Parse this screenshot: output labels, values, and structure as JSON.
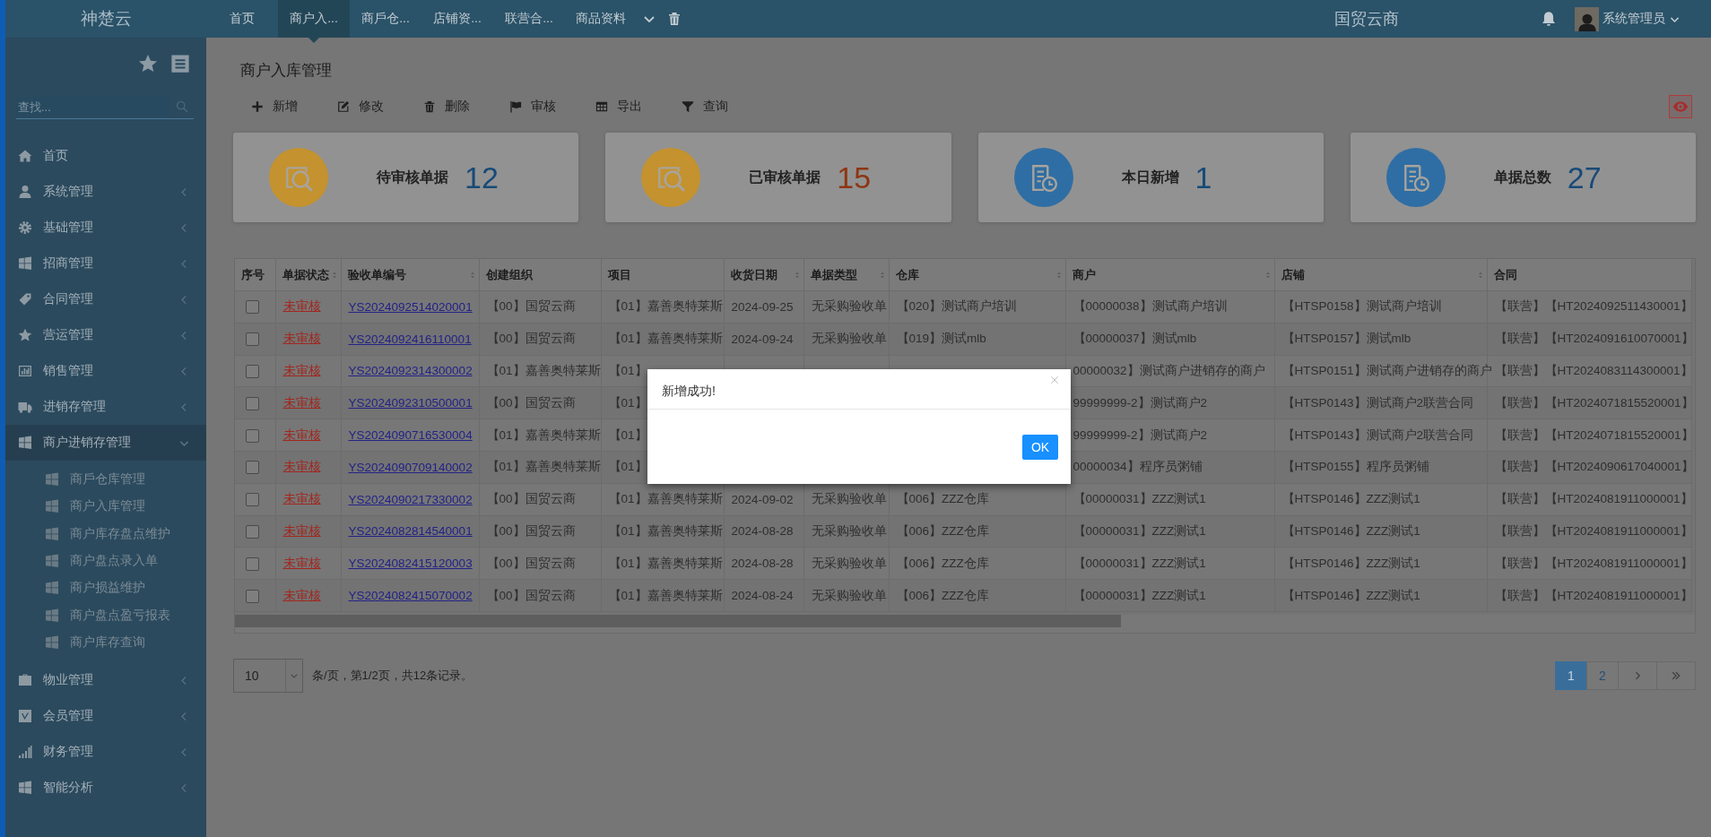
{
  "topbar": {
    "logo": "神楚云",
    "tabs": [
      {
        "label": "首页",
        "selected": false
      },
      {
        "label": "商户入...",
        "selected": true
      },
      {
        "label": "商戶仓...",
        "selected": false
      },
      {
        "label": "店铺资...",
        "selected": false
      },
      {
        "label": "联营合...",
        "selected": false
      },
      {
        "label": "商品资料",
        "selected": false
      }
    ],
    "brand": "国贸云商",
    "user": "系统管理员"
  },
  "sidebar": {
    "search": {
      "placeholder": "查找..."
    },
    "items": [
      {
        "kind": "link",
        "label": "首页",
        "expanded": false
      },
      {
        "kind": "group",
        "label": "系统管理",
        "expanded": false
      },
      {
        "kind": "group",
        "label": "基础管理",
        "expanded": false
      },
      {
        "kind": "group",
        "label": "招商管理",
        "expanded": false
      },
      {
        "kind": "group",
        "label": "合同管理",
        "expanded": false
      },
      {
        "kind": "group",
        "label": "营运管理",
        "expanded": false
      },
      {
        "kind": "group",
        "label": "销售管理",
        "expanded": false
      },
      {
        "kind": "group",
        "label": "进销存管理",
        "expanded": false
      },
      {
        "kind": "group",
        "label": "商户进销存管理",
        "expanded": true,
        "children": [
          {
            "label": "商戶仓库管理"
          },
          {
            "label": "商户入库管理"
          },
          {
            "label": "商户库存盘点维护"
          },
          {
            "label": "商户盘点录入单"
          },
          {
            "label": "商户损益维护"
          },
          {
            "label": "商户盘点盈亏报表"
          },
          {
            "label": "商户库存查询"
          }
        ]
      },
      {
        "kind": "group",
        "label": "物业管理",
        "expanded": false
      },
      {
        "kind": "group",
        "label": "会员管理",
        "expanded": false
      },
      {
        "kind": "group",
        "label": "财务管理",
        "expanded": false
      },
      {
        "kind": "group",
        "label": "智能分析",
        "expanded": false
      }
    ]
  },
  "page": {
    "title": "商户入库管理",
    "toolbar": [
      "新增",
      "修改",
      "删除",
      "审核",
      "导出",
      "查询"
    ]
  },
  "cards": [
    {
      "kind": "search",
      "label": "待审核单据",
      "value": "12",
      "color": "#174a78"
    },
    {
      "kind": "search",
      "label": "已审核单据",
      "value": "15",
      "color": "#8e3512"
    },
    {
      "kind": "document",
      "label": "本日新增",
      "value": "1",
      "color": "#174a78"
    },
    {
      "kind": "document",
      "label": "单据总数",
      "value": "27",
      "color": "#174a78"
    }
  ],
  "table": {
    "columns": [
      {
        "label": "序号",
        "sortable": false
      },
      {
        "label": "单据状态",
        "sortable": true
      },
      {
        "label": "验收单编号",
        "sortable": true
      },
      {
        "label": "创建组织",
        "sortable": false
      },
      {
        "label": "项目",
        "sortable": false
      },
      {
        "label": "收货日期",
        "sortable": true
      },
      {
        "label": "单据类型",
        "sortable": true
      },
      {
        "label": "仓库",
        "sortable": true
      },
      {
        "label": "商户",
        "sortable": true
      },
      {
        "label": "店铺",
        "sortable": true
      },
      {
        "label": "合同",
        "sortable": false
      }
    ],
    "rows": [
      {
        "cells": [
          {
            "checked": false
          },
          "未审核",
          "YS2024092514020001",
          "【00】国贸云商",
          "【01】嘉善奥特莱斯",
          "2024-09-25",
          "无采购验收单",
          "【020】测试商户培训",
          "【00000038】测试商户培训",
          "【HTSP0158】测试商户培训",
          "【联营】【HT2024092511430001】"
        ]
      },
      {
        "cells": [
          {
            "checked": false
          },
          "未审核",
          "YS2024092416110001",
          "【00】国贸云商",
          "【01】嘉善奥特莱斯",
          "2024-09-24",
          "无采购验收单",
          "【019】测试mlb",
          "【00000037】测试mlb",
          "【HTSP0157】测试mlb",
          "【联营】【HT2024091610070001】"
        ]
      },
      {
        "cells": [
          {
            "checked": false
          },
          "未审核",
          "YS2024092314300002",
          "【01】嘉善奥特莱斯",
          "【01】",
          null,
          null,
          null,
          "00000032】测试商户进销存的商户",
          "【HTSP0151】测试商户进销存的商户",
          "【联营】【HT2024083114300001】"
        ]
      },
      {
        "cells": [
          {
            "checked": false
          },
          "未审核",
          "YS2024092310500001",
          "【00】国贸云商",
          "【01】",
          null,
          null,
          null,
          "99999999-2】测试商户2",
          "【HTSP0143】测试商户2联营合同",
          "【联营】【HT2024071815520001】"
        ]
      },
      {
        "cells": [
          {
            "checked": false
          },
          "未审核",
          "YS2024090716530004",
          "【01】嘉善奥特莱斯",
          "【01】",
          null,
          null,
          null,
          "99999999-2】测试商户2",
          "【HTSP0143】测试商户2联营合同",
          "【联营】【HT2024071815520001】"
        ]
      },
      {
        "cells": [
          {
            "checked": false
          },
          "未审核",
          "YS2024090709140002",
          "【01】嘉善奥特莱斯",
          "【01】",
          null,
          null,
          null,
          "00000034】程序员粥铺",
          "【HTSP0155】程序员粥铺",
          "【联营】【HT2024090617040001】"
        ]
      },
      {
        "cells": [
          {
            "checked": false
          },
          "未审核",
          "YS2024090217330002",
          "【00】国贸云商",
          "【01】嘉善奥特莱斯",
          "2024-09-02",
          "无采购验收单",
          "【006】ZZZ仓库",
          "【00000031】ZZZ测试1",
          "【HTSP0146】ZZZ测试1",
          "【联营】【HT2024081911000001】"
        ]
      },
      {
        "cells": [
          {
            "checked": false
          },
          "未审核",
          "YS2024082814540001",
          "【00】国贸云商",
          "【01】嘉善奥特莱斯",
          "2024-08-28",
          "无采购验收单",
          "【006】ZZZ仓库",
          "【00000031】ZZZ测试1",
          "【HTSP0146】ZZZ测试1",
          "【联营】【HT2024081911000001】"
        ]
      },
      {
        "cells": [
          {
            "checked": false
          },
          "未审核",
          "YS2024082415120003",
          "【00】国贸云商",
          "【01】嘉善奥特莱斯",
          "2024-08-28",
          "无采购验收单",
          "【006】ZZZ仓库",
          "【00000031】ZZZ测试1",
          "【HTSP0146】ZZZ测试1",
          "【联营】【HT2024081911000001】"
        ]
      },
      {
        "cells": [
          {
            "checked": false
          },
          "未审核",
          "YS2024082415070002",
          "【00】国贸云商",
          "【01】嘉善奥特莱斯",
          "2024-08-24",
          "无采购验收单",
          "【006】ZZZ仓库",
          "【00000031】ZZZ测试1",
          "【HTSP0146】ZZZ测试1",
          "【联营】【HT2024081911000001】"
        ]
      }
    ]
  },
  "pager": {
    "page_size": "10",
    "summary": "条/页，第1/2页，共12条记录。",
    "pages": [
      {
        "label": "1",
        "selected": true
      },
      {
        "label": "2",
        "selected": false
      }
    ]
  },
  "dialog": {
    "message": "新增成功!",
    "button": "OK"
  }
}
